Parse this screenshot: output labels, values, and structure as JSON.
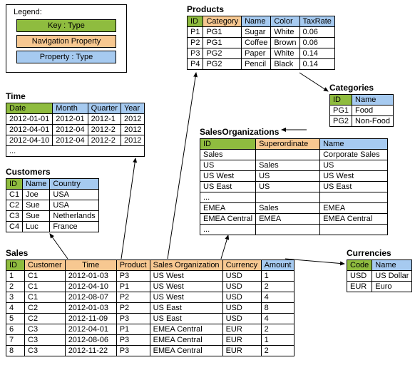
{
  "legend": {
    "title": "Legend:",
    "key": "Key : Type",
    "nav": "Navigation Property",
    "prop": "Property : Type"
  },
  "time": {
    "title": "Time",
    "h": {
      "date": "Date",
      "month": "Month",
      "quarter": "Quarter",
      "year": "Year"
    },
    "rows": [
      {
        "date": "2012-01-01",
        "month": "2012-01",
        "quarter": "2012-1",
        "year": "2012"
      },
      {
        "date": "2012-04-01",
        "month": "2012-04",
        "quarter": "2012-2",
        "year": "2012"
      },
      {
        "date": "2012-04-10",
        "month": "2012-04",
        "quarter": "2012-2",
        "year": "2012"
      }
    ],
    "ell": "..."
  },
  "customers": {
    "title": "Customers",
    "h": {
      "id": "ID",
      "name": "Name",
      "country": "Country"
    },
    "rows": [
      {
        "id": "C1",
        "name": "Joe",
        "country": "USA"
      },
      {
        "id": "C2",
        "name": "Sue",
        "country": "USA"
      },
      {
        "id": "C3",
        "name": "Sue",
        "country": "Netherlands"
      },
      {
        "id": "C4",
        "name": "Luc",
        "country": "France"
      }
    ]
  },
  "products": {
    "title": "Products",
    "h": {
      "id": "ID",
      "category": "Category",
      "name": "Name",
      "color": "Color",
      "tax": "TaxRate"
    },
    "rows": [
      {
        "id": "P1",
        "category": "PG1",
        "name": "Sugar",
        "color": "White",
        "tax": "0.06"
      },
      {
        "id": "P2",
        "category": "PG1",
        "name": "Coffee",
        "color": "Brown",
        "tax": "0.06"
      },
      {
        "id": "P3",
        "category": "PG2",
        "name": "Paper",
        "color": "White",
        "tax": "0.14"
      },
      {
        "id": "P4",
        "category": "PG2",
        "name": "Pencil",
        "color": "Black",
        "tax": "0.14"
      }
    ]
  },
  "categories": {
    "title": "Categories",
    "h": {
      "id": "ID",
      "name": "Name"
    },
    "rows": [
      {
        "id": "PG1",
        "name": "Food"
      },
      {
        "id": "PG2",
        "name": "Non-Food"
      }
    ]
  },
  "salesorgs": {
    "title": "SalesOrganizations",
    "h": {
      "id": "ID",
      "super": "Superordinate",
      "name": "Name"
    },
    "rows": [
      {
        "id": "Sales",
        "super": "",
        "name": "Corporate Sales"
      },
      {
        "id": "US",
        "super": "Sales",
        "name": "US"
      },
      {
        "id": "US West",
        "super": "US",
        "name": "US West"
      },
      {
        "id": "US East",
        "super": "US",
        "name": "US East"
      },
      {
        "id": "...",
        "super": "",
        "name": ""
      },
      {
        "id": "EMEA",
        "super": "Sales",
        "name": "EMEA"
      },
      {
        "id": "EMEA Central",
        "super": "EMEA",
        "name": "EMEA Central"
      },
      {
        "id": "...",
        "super": "",
        "name": ""
      }
    ]
  },
  "currencies": {
    "title": "Currencies",
    "h": {
      "code": "Code",
      "name": "Name"
    },
    "rows": [
      {
        "code": "USD",
        "name": "US Dollar"
      },
      {
        "code": "EUR",
        "name": "Euro"
      }
    ]
  },
  "sales": {
    "title": "Sales",
    "h": {
      "id": "ID",
      "customer": "Customer",
      "time": "Time",
      "product": "Product",
      "org": "Sales Organization",
      "currency": "Currency",
      "amount": "Amount"
    },
    "rows": [
      {
        "id": "1",
        "customer": "C1",
        "time": "2012-01-03",
        "product": "P3",
        "org": "US West",
        "currency": "USD",
        "amount": "1"
      },
      {
        "id": "2",
        "customer": "C1",
        "time": "2012-04-10",
        "product": "P1",
        "org": "US West",
        "currency": "USD",
        "amount": "2"
      },
      {
        "id": "3",
        "customer": "C1",
        "time": "2012-08-07",
        "product": "P2",
        "org": "US West",
        "currency": "USD",
        "amount": "4"
      },
      {
        "id": "4",
        "customer": "C2",
        "time": "2012-01-03",
        "product": "P2",
        "org": "US East",
        "currency": "USD",
        "amount": "8"
      },
      {
        "id": "5",
        "customer": "C2",
        "time": "2012-11-09",
        "product": "P3",
        "org": "US East",
        "currency": "USD",
        "amount": "4"
      },
      {
        "id": "6",
        "customer": "C3",
        "time": "2012-04-01",
        "product": "P1",
        "org": "EMEA Central",
        "currency": "EUR",
        "amount": "2"
      },
      {
        "id": "7",
        "customer": "C3",
        "time": "2012-08-06",
        "product": "P3",
        "org": "EMEA Central",
        "currency": "EUR",
        "amount": "1"
      },
      {
        "id": "8",
        "customer": "C3",
        "time": "2012-11-22",
        "product": "P3",
        "org": "EMEA Central",
        "currency": "EUR",
        "amount": "2"
      }
    ]
  }
}
